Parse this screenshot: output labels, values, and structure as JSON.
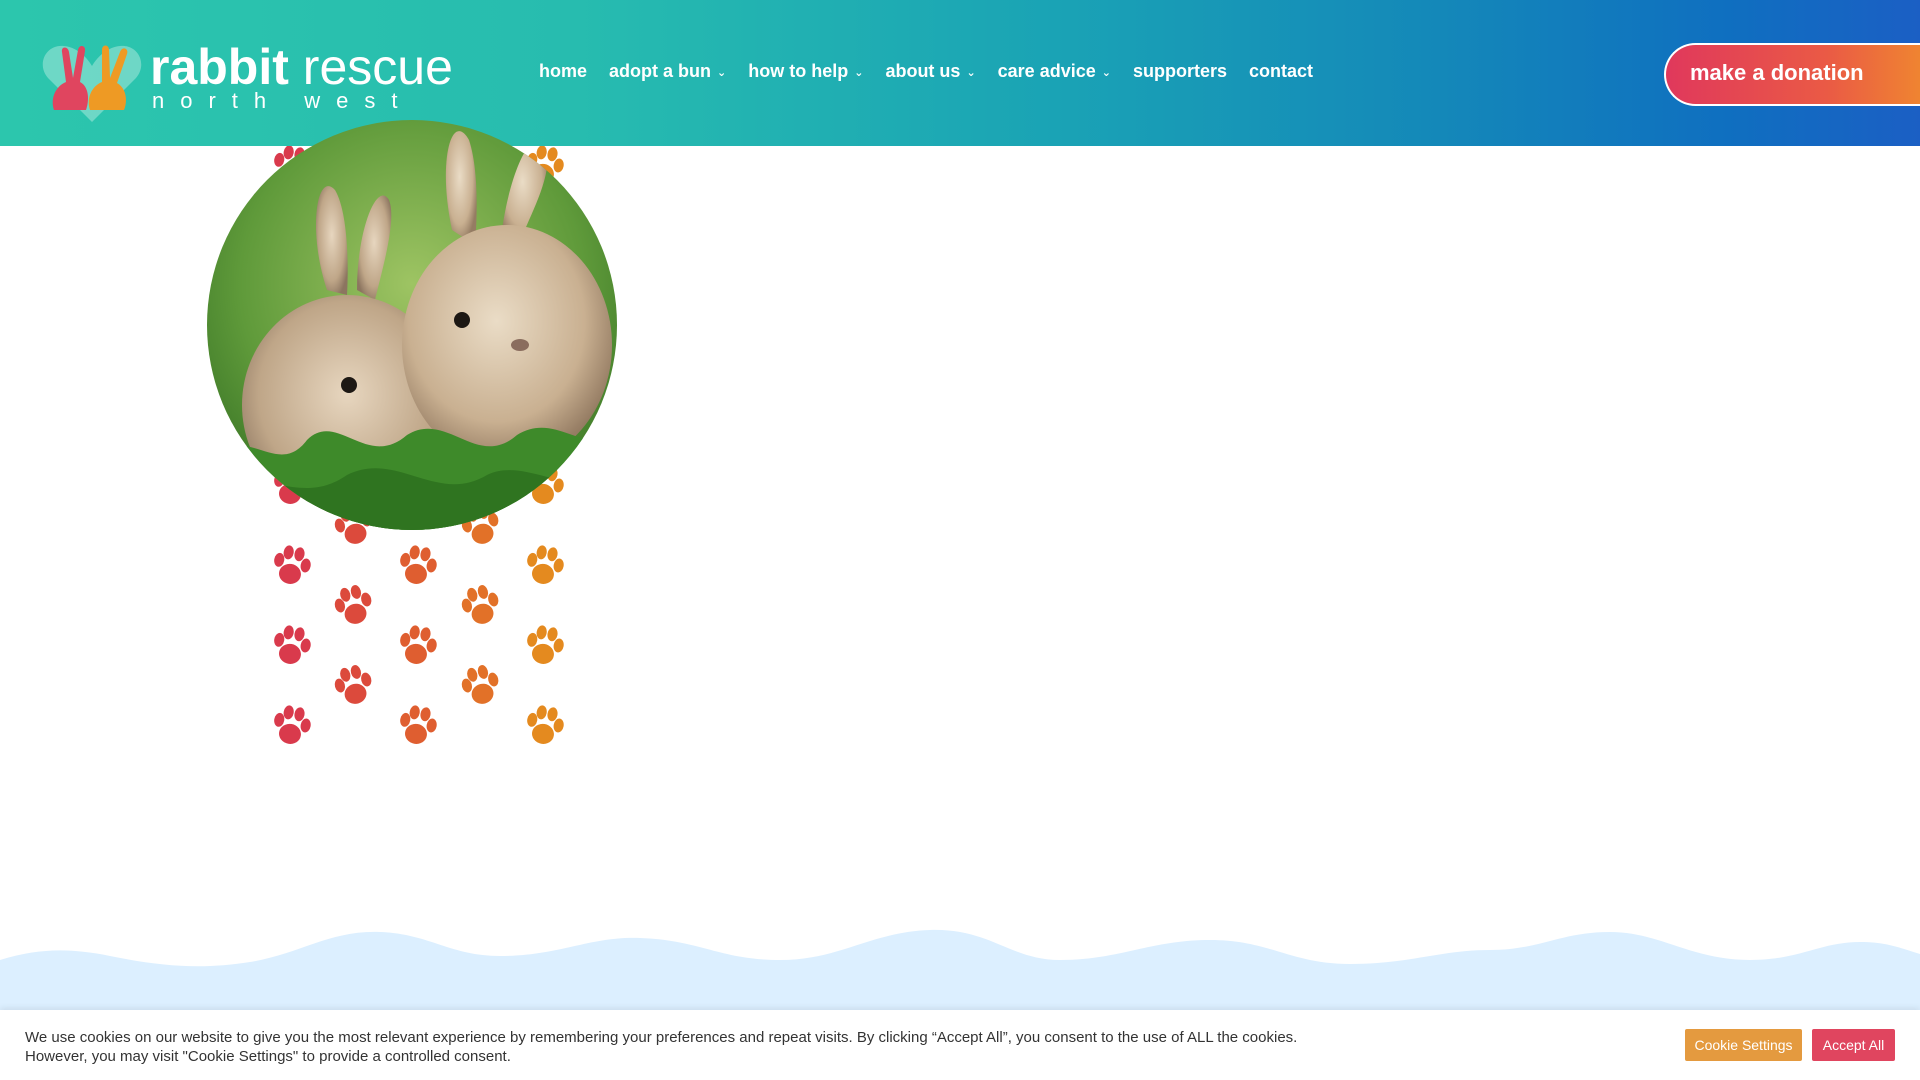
{
  "brand": {
    "name_bold": "rabbit",
    "name_regular": " rescue",
    "subtitle": "north west"
  },
  "nav": {
    "items": [
      {
        "label": "home",
        "has_dropdown": false
      },
      {
        "label": "adopt a bun",
        "has_dropdown": true
      },
      {
        "label": "how to help",
        "has_dropdown": true
      },
      {
        "label": "about us",
        "has_dropdown": true
      },
      {
        "label": "care advice",
        "has_dropdown": true
      },
      {
        "label": "supporters",
        "has_dropdown": false
      },
      {
        "label": "contact",
        "has_dropdown": false
      }
    ],
    "chevron_icon": "chevron-down-icon"
  },
  "donate": {
    "label": "make a donation"
  },
  "cookie": {
    "line1": "We use cookies on our website to give you the most relevant experience by remembering your preferences and repeat visits. By clicking “Accept All”, you consent to the use of ALL the cookies.",
    "line2": "However, you may visit \"Cookie Settings\" to provide a controlled consent.",
    "settings_label": "Cookie Settings",
    "accept_label": "Accept All"
  },
  "colors": {
    "header_start": "#2cc6ad",
    "header_end": "#1b5fc4",
    "paw_red": "#d93a4c",
    "paw_orange": "#e48a1f",
    "wave": "#dcefff",
    "settings_button": "#e49a3f",
    "accept_button": "#e0455f"
  }
}
